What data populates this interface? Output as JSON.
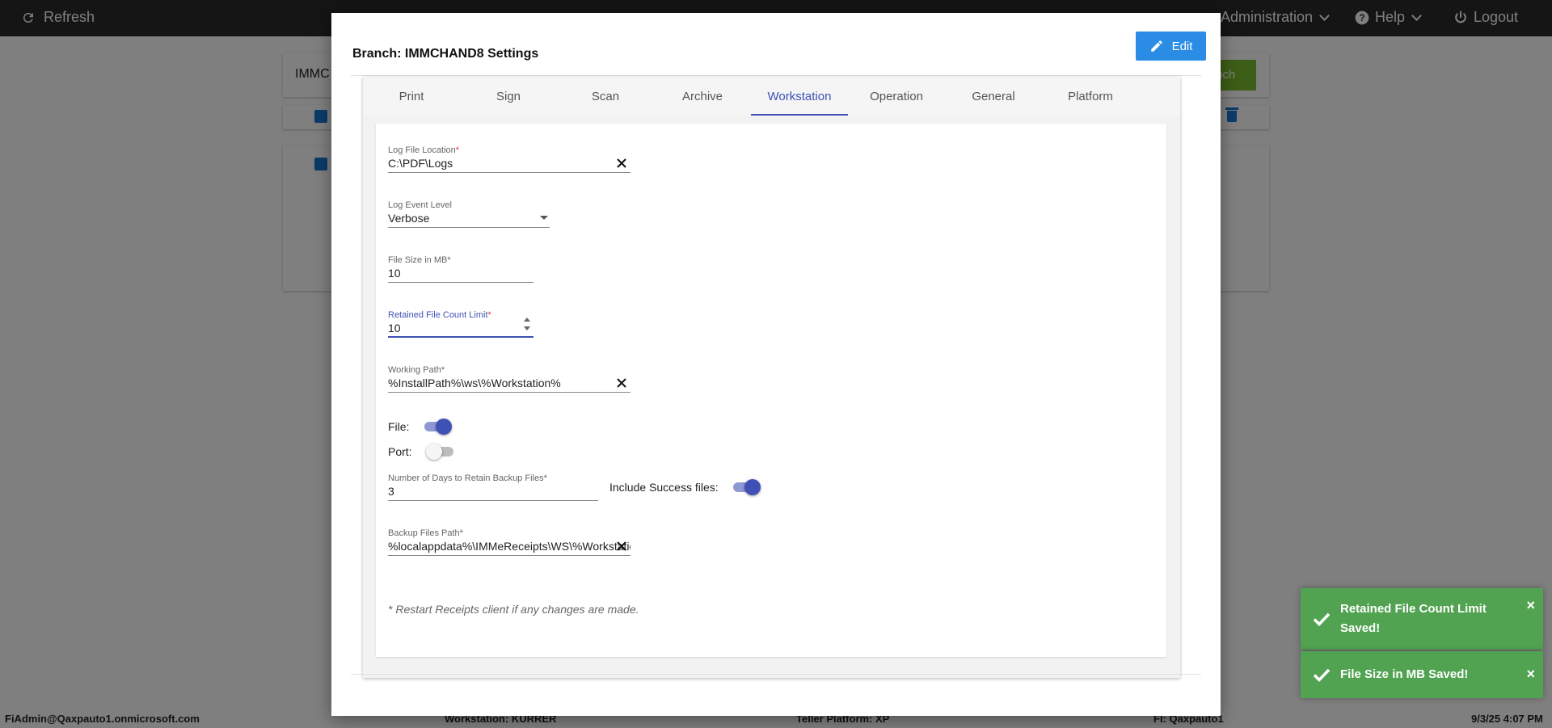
{
  "topbar": {
    "refresh_label": "Refresh",
    "administration_label": "Administration",
    "help_label": "Help",
    "logout_label": "Logout"
  },
  "background": {
    "search_text": "IMMC",
    "green_button_label": "nch"
  },
  "footer": {
    "user": "FiAdmin@Qaxpauto1.onmicrosoft.com",
    "workstation": "Workstation: KURRER",
    "teller_platform": "Teller Platform: XP",
    "fi": "FI: Qaxpauto1",
    "datetime": "9/3/25 4:07 PM"
  },
  "modal": {
    "title": "Branch: IMMCHAND8 Settings",
    "edit_label": "Edit",
    "tabs": [
      {
        "label": "Print"
      },
      {
        "label": "Sign"
      },
      {
        "label": "Scan"
      },
      {
        "label": "Archive"
      },
      {
        "label": "Workstation"
      },
      {
        "label": "Operation"
      },
      {
        "label": "General"
      },
      {
        "label": "Platform"
      }
    ],
    "active_tab": "Workstation",
    "fields": {
      "log_file_location": {
        "label": "Log File Location",
        "required_mark": "*",
        "value": "C:\\PDF\\Logs"
      },
      "log_event_level": {
        "label": "Log Event Level",
        "value": "Verbose"
      },
      "file_size_mb": {
        "label": "File Size in MB",
        "required_mark": "*",
        "value": "10"
      },
      "retained_file_count": {
        "label": "Retained File Count Limit",
        "required_mark": "*",
        "value": "10"
      },
      "working_path": {
        "label": "Working Path",
        "required_mark": "*",
        "value": "%InstallPath%\\ws\\%Workstation%"
      },
      "file_toggle": {
        "label": "File:",
        "on": true
      },
      "port_toggle": {
        "label": "Port:",
        "on": false
      },
      "days_retain_backup": {
        "label": "Number of Days to Retain Backup Files",
        "required_mark": "*",
        "value": "3"
      },
      "include_success": {
        "label": "Include Success files:",
        "on": true
      },
      "backup_files_path": {
        "label": "Backup Files Path",
        "required_mark": "*",
        "value": "%localappdata%\\IMMeReceipts\\WS\\%Workstation%"
      }
    },
    "note": "* Restart Receipts client if any changes are made."
  },
  "toasts": [
    {
      "message": "Retained File Count Limit Saved!",
      "close": "×"
    },
    {
      "message": "File Size in MB Saved!",
      "close": "×"
    }
  ],
  "colors": {
    "accent": "#3f51b5",
    "edit_button": "#2b8ce6",
    "toast_success": "#51a351",
    "topbar": "#2b2b2b"
  },
  "icons": [
    "refresh-icon",
    "help-icon",
    "logout-icon",
    "pencil-icon",
    "close-icon",
    "checkmark-icon",
    "trash-icon"
  ]
}
